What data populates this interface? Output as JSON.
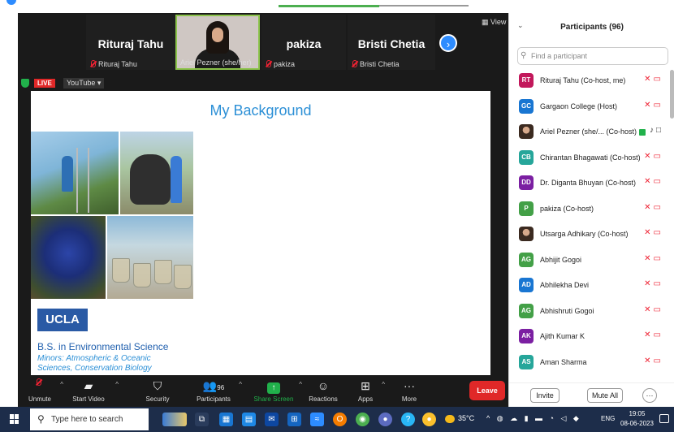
{
  "tiles": {
    "participants": [
      {
        "big": "Rituraj Tahu",
        "small": "Rituraj Tahu",
        "muted": true
      },
      {
        "big": "",
        "small": "Ariel Pezner (she/her)",
        "muted": false
      },
      {
        "big": "pakiza",
        "small": "pakiza",
        "muted": true
      },
      {
        "big": "Bristi Chetia",
        "small": "Bristi Chetia",
        "muted": true
      }
    ],
    "view_label": "View",
    "next_icon": "chevron-right-icon"
  },
  "live": {
    "badge": "LIVE",
    "platform": "YouTube ▾"
  },
  "slide": {
    "title": "My Background",
    "logo": "UCLA",
    "degree": "B.S. in Environmental Science",
    "minors": "Minors: Atmospheric & Oceanic Sciences, Conservation Biology"
  },
  "toolbar": {
    "unmute": "Unmute",
    "start_video": "Start Video",
    "security": "Security",
    "participants": "Participants",
    "participants_count": "96",
    "share_screen": "Share Screen",
    "reactions": "Reactions",
    "apps": "Apps",
    "more": "More",
    "leave": "Leave"
  },
  "panel": {
    "title": "Participants (96)",
    "search_placeholder": "Find a participant",
    "list": [
      {
        "initials": "RT",
        "color": "#c2185b",
        "name": "Rituraj Tahu (Co-host, me)",
        "status": "off"
      },
      {
        "initials": "GC",
        "color": "#1976d2",
        "name": "Gargaon College (Host)",
        "status": "off"
      },
      {
        "initials": "",
        "color": "",
        "name": "Ariel Pezner (she/... (Co-host)",
        "status": "on"
      },
      {
        "initials": "CB",
        "color": "#26a69a",
        "name": "Chirantan Bhagawati (Co-host)",
        "status": "off"
      },
      {
        "initials": "DD",
        "color": "#7b1fa2",
        "name": "Dr. Diganta Bhuyan (Co-host)",
        "status": "off"
      },
      {
        "initials": "P",
        "color": "#43a047",
        "name": "pakiza (Co-host)",
        "status": "off"
      },
      {
        "initials": "",
        "color": "",
        "name": "Utsarga Adhikary (Co-host)",
        "status": "off"
      },
      {
        "initials": "AG",
        "color": "#43a047",
        "name": "Abhijit Gogoi",
        "status": "off"
      },
      {
        "initials": "AD",
        "color": "#1976d2",
        "name": "Abhilekha Devi",
        "status": "off"
      },
      {
        "initials": "AG",
        "color": "#43a047",
        "name": "Abhishruti Gogoi",
        "status": "off"
      },
      {
        "initials": "AK",
        "color": "#7b1fa2",
        "name": "Ajith Kumar K",
        "status": "off"
      },
      {
        "initials": "AS",
        "color": "#26a69a",
        "name": "Aman Sharma",
        "status": "off"
      }
    ],
    "invite": "Invite",
    "mute_all": "Mute All",
    "more": "···"
  },
  "taskbar": {
    "search_placeholder": "Type here to search",
    "weather": "35°C",
    "lang": "ENG",
    "time": "19:05",
    "date": "08-06-2023"
  }
}
